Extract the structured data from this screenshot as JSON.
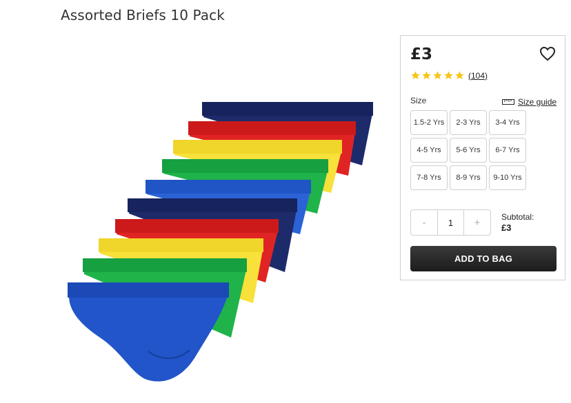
{
  "product": {
    "title": "Assorted Briefs 10 Pack",
    "image_alt": "Assorted Briefs 10 Pack image"
  },
  "panel": {
    "price": "£3",
    "rating": {
      "stars": 5,
      "max": 5,
      "review_count": "(104)",
      "star_color": "#f5c518"
    },
    "size_label": "Size",
    "size_guide_label": "Size guide",
    "sizes": [
      "1.5-2 Yrs",
      "2-3 Yrs",
      "3-4 Yrs",
      "4-5 Yrs",
      "5-6 Yrs",
      "6-7 Yrs",
      "7-8 Yrs",
      "8-9 Yrs",
      "9-10 Yrs"
    ],
    "quantity": {
      "minus": "-",
      "value": "1",
      "plus": "+"
    },
    "subtotal_label": "Subtotal:",
    "subtotal_value": "£3",
    "add_to_bag_label": "ADD TO BAG",
    "colors": {
      "button": "#2a2a2a",
      "border": "#cfcfcf"
    }
  },
  "icons": {
    "wishlist": "heart-icon",
    "size_guide": "ruler-icon",
    "star": "star-icon"
  }
}
